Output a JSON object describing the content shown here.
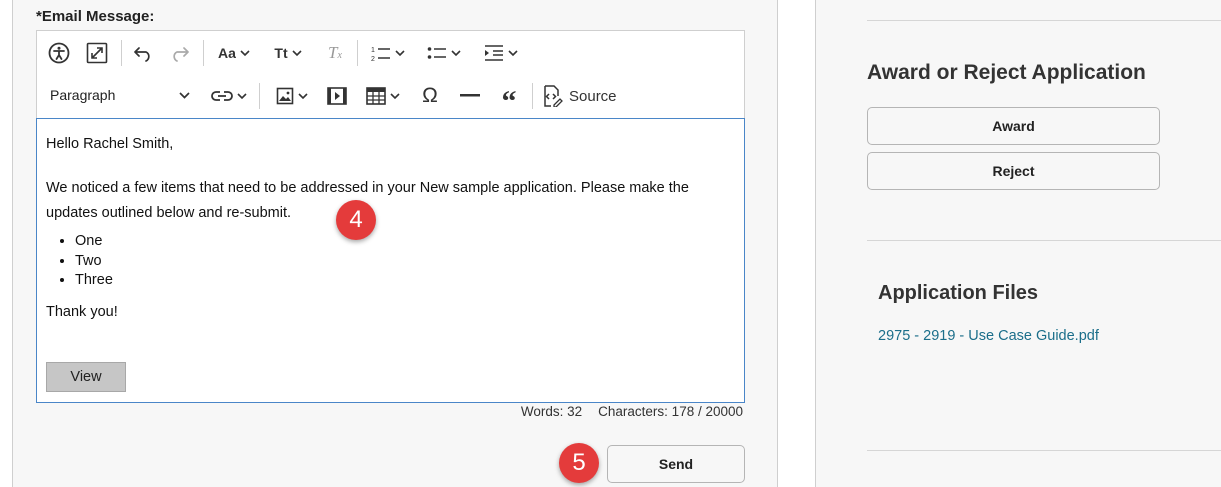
{
  "email": {
    "label": "*Email Message:",
    "toolbar": {
      "row1": [
        "accessibility-icon",
        "fullscreen-icon",
        "undo-icon",
        "redo-icon",
        "font-family-icon",
        "font-size-icon",
        "remove-format-icon",
        "numbered-list-icon",
        "bulleted-list-icon",
        "indent-icon"
      ],
      "paragraph_style": "Paragraph",
      "row2": [
        "link-icon",
        "image-icon",
        "media-icon",
        "table-icon",
        "special-character-icon",
        "horizontal-line-icon",
        "blockquote-icon",
        "source-icon"
      ],
      "source_label": "Source"
    },
    "body": {
      "greeting": "Hello Rachel Smith,",
      "message_line1": "We noticed a few items that need to be addressed in your New sample application. Please make the",
      "message_line2": "updates outlined below and re-submit.",
      "bullets": [
        "One",
        "Two",
        "Three"
      ],
      "closing": "Thank you!"
    },
    "view_label": "View",
    "counts": {
      "words": "Words: 32",
      "characters": "Characters: 178 / 20000"
    },
    "send_label": "Send"
  },
  "annotations": {
    "step4": "4",
    "step5": "5",
    "color": "#e43b3b"
  },
  "sidebar": {
    "award_section": {
      "title": "Award or Reject Application",
      "award_label": "Award",
      "reject_label": "Reject"
    },
    "files_section": {
      "title": "Application Files",
      "files": [
        "2975 - 2919 - Use Case Guide.pdf"
      ]
    }
  },
  "colors": {
    "link": "#1b6e8a",
    "editor_border": "#4a86c8",
    "panel_bg": "#f7f7f7"
  }
}
